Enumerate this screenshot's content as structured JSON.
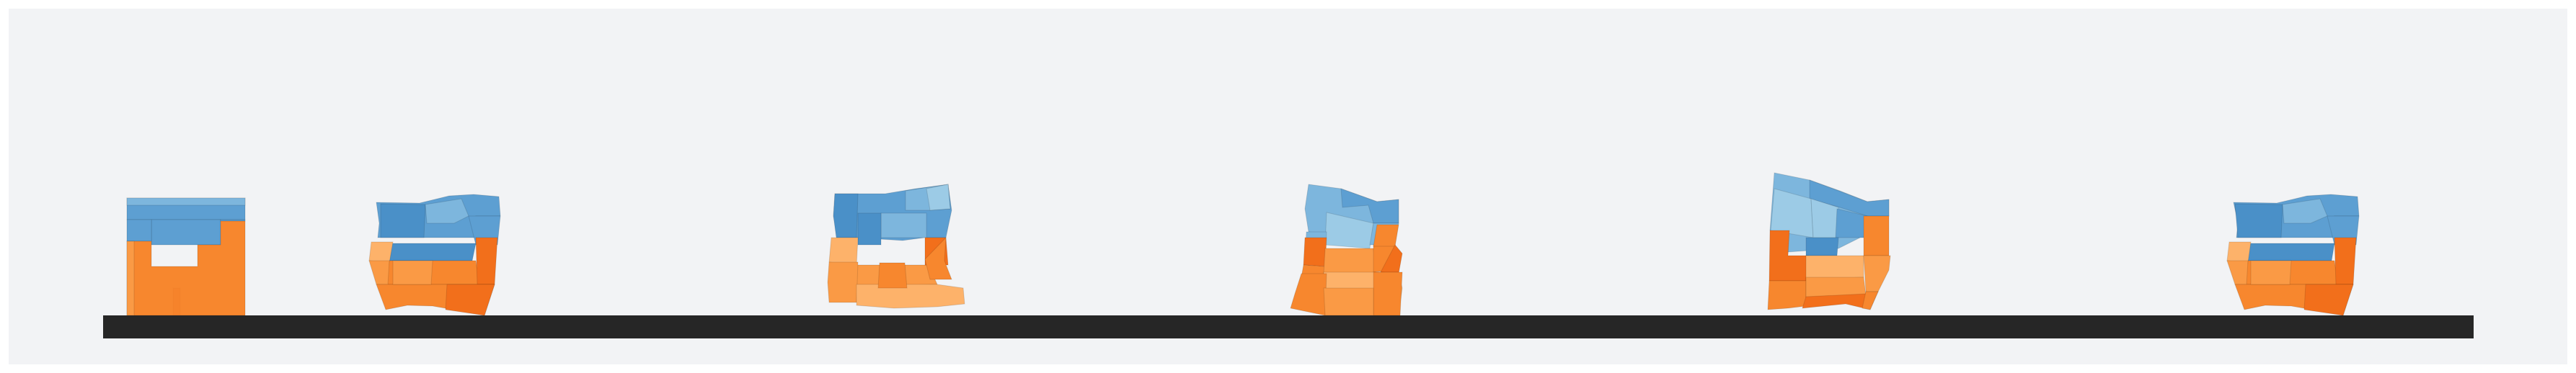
{
  "scene": {
    "background_color": "#f2f3f5",
    "frame_color": "#ffffff",
    "ground_color": "#262626",
    "palette": {
      "blue_dark": "#4a90c8",
      "blue_mid": "#5d9fd2",
      "blue_light": "#7db6dd",
      "blue_pale": "#9ccbe6",
      "orange_dark": "#f26f1b",
      "orange_mid": "#f7872e",
      "orange_light": "#fa9a45",
      "orange_pale": "#fdb26a"
    },
    "objects": [
      {
        "name": "soft-body-initial",
        "state": "rest"
      },
      {
        "name": "soft-body-frame-1",
        "state": "deformed"
      },
      {
        "name": "soft-body-frame-2",
        "state": "deformed"
      },
      {
        "name": "soft-body-frame-3",
        "state": "deformed"
      },
      {
        "name": "soft-body-frame-4",
        "state": "deformed"
      },
      {
        "name": "soft-body-frame-5",
        "state": "deformed"
      }
    ]
  }
}
